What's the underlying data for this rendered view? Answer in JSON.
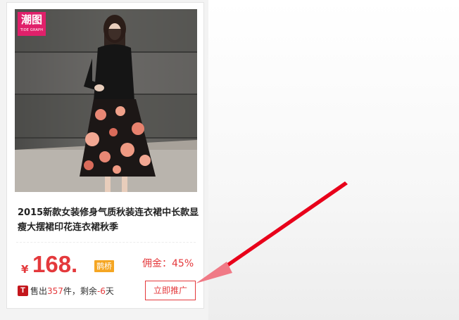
{
  "product": {
    "brand_logo_text": "潮图",
    "brand_logo_subtext": "TIDE GRAPH",
    "title": "2015新款女装修身气质秋装连衣裙中长款显瘦大摆裙印花连衣裙秋季",
    "price_symbol": "¥",
    "price": "168.",
    "badge": "鹊桥",
    "commission_label": "佣金：",
    "commission_value": "45%",
    "platform_icon": "T",
    "sold_prefix": "售出",
    "sold_count": "357",
    "sold_unit": "件，剩余",
    "days_left": "-6",
    "days_unit": "天",
    "promote_label": "立即推广"
  },
  "colors": {
    "accent": "#e4393c",
    "badge": "#f5a623",
    "logo": "#e0206a",
    "tmall": "#c4161c",
    "annotation_arrow": "#e8001a"
  },
  "icons": {
    "platform": "tmall-icon",
    "annotation": "red-arrow-annotation"
  }
}
